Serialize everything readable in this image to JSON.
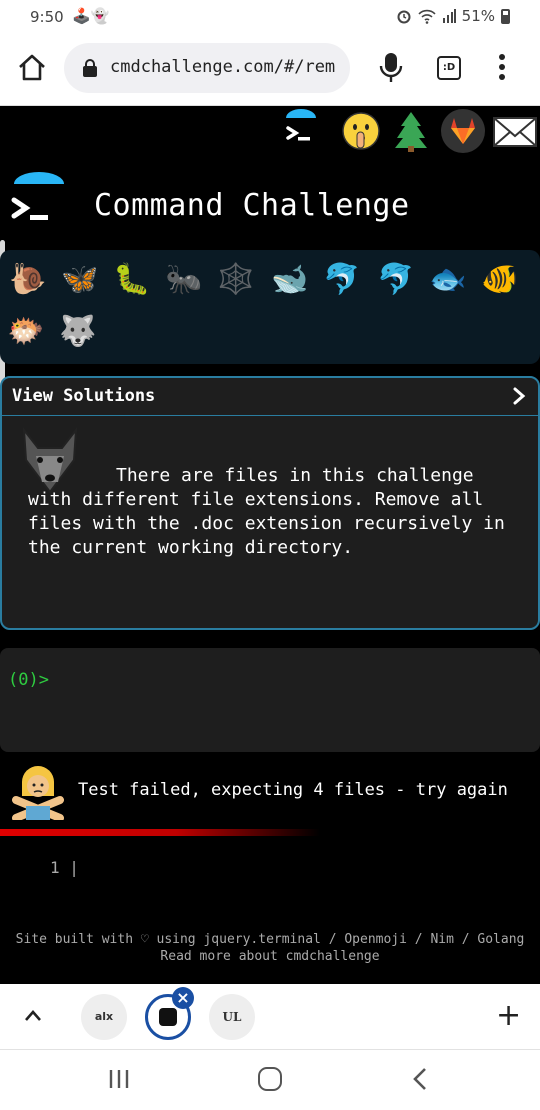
{
  "status_bar": {
    "time": "9:50",
    "battery": "51%",
    "left_icons": "🕹️👻"
  },
  "browser": {
    "url": "cmdchallenge.com/#/rem",
    "tab_count_label": ":D"
  },
  "header_icons": [
    "terminal-icon",
    "shushing-face-icon",
    "tree-icon",
    "gitlab-icon",
    "mail-icon"
  ],
  "title": "Command Challenge",
  "animals": [
    "🐌",
    "🦋",
    "🐛",
    "🐜",
    "🕸️",
    "🐋",
    "🐬",
    "🐬",
    "🐟",
    "🐠",
    "🐡",
    "🐺"
  ],
  "solutions": {
    "label": "View Solutions",
    "challenge_text": "There are files in this challenge with different file extensions. Remove all files with the .doc extension recursively in the current working directory."
  },
  "terminal": {
    "prompt": "(0)>"
  },
  "result": {
    "message": "Test failed, expecting 4 files - try again",
    "line_number": "1 |"
  },
  "footer": {
    "line1": "Site built with ♡ using jquery.terminal / Openmoji / Nim / Golang",
    "line2": "Read more about cmdchallenge"
  },
  "tabs": [
    {
      "label": "alx"
    },
    {
      "label": ""
    },
    {
      "label": "UL"
    }
  ],
  "colors": {
    "accent": "#2a7da0",
    "prompt": "#2ecc40",
    "fail_bar": "#e00000",
    "tab_active": "#1a4fa3"
  }
}
